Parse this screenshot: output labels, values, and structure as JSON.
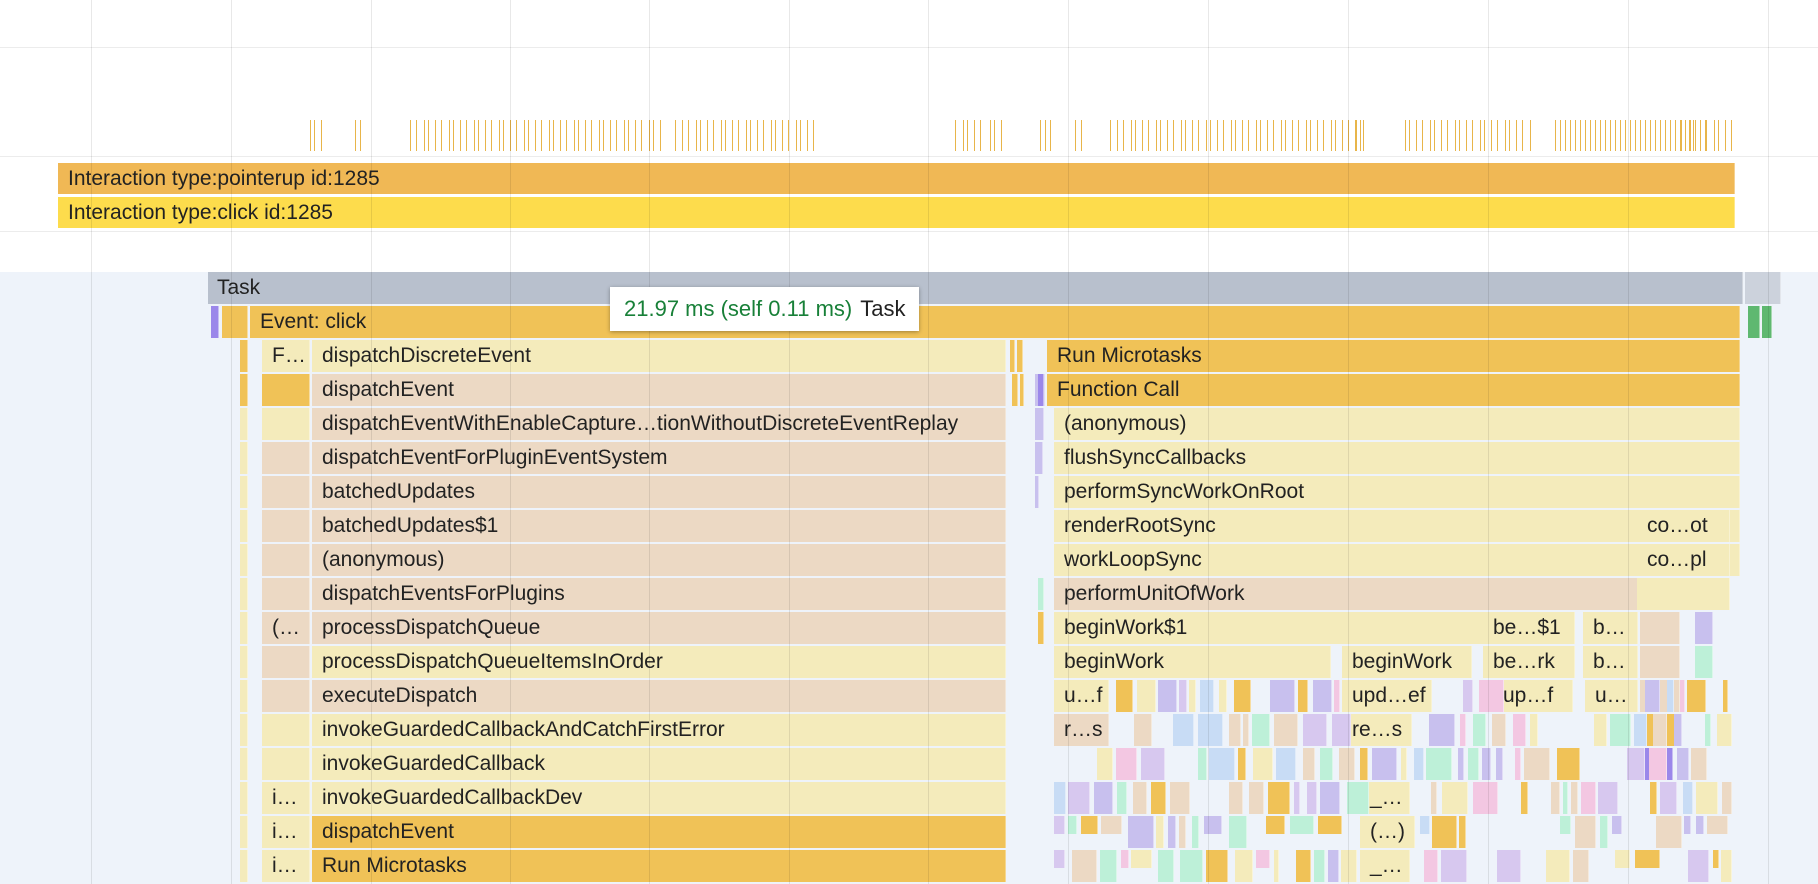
{
  "interactions": [
    {
      "label": "Interaction type:pointerup id:1285",
      "color": "#f0b855"
    },
    {
      "label": "Interaction type:click id:1285",
      "color": "#fddc4c"
    }
  ],
  "tooltip": {
    "duration": "21.97 ms (self 0.11 ms)",
    "name": "Task"
  },
  "task": {
    "label": "Task",
    "color": "#b8c0cd"
  },
  "event": {
    "label": "Event: click"
  },
  "colors": {
    "dark": "#f0c257",
    "light": "#f4ebbb",
    "pink": "#ecd9c4",
    "gray": "#b8c0cd",
    "purple": "#9b87ea",
    "lavender": "#c8c0ee",
    "mint": "#bdf0d8",
    "blue": "#c8dcf5",
    "tip_green": "#188038"
  },
  "left_stack": [
    "dispatchDiscreteEvent",
    "dispatchEvent",
    "dispatchEventWithEnableCapture…tionWithoutDiscreteEventReplay",
    "dispatchEventForPluginEventSystem",
    "batchedUpdates",
    "batchedUpdates$1",
    "(anonymous)",
    "dispatchEventsForPlugins",
    "processDispatchQueue",
    "processDispatchQueueItemsInOrder",
    "executeDispatch",
    "invokeGuardedCallbackAndCatchFirstError",
    "invokeGuardedCallback",
    "invokeGuardedCallbackDev",
    "dispatchEvent",
    "Run Microtasks"
  ],
  "left_small": {
    "f": "F…",
    "p": "(…",
    "i1": "i…",
    "i2": "i…",
    "i3": "i…"
  },
  "right_stack": [
    "Run Microtasks",
    "Function Call",
    "(anonymous)",
    "flushSyncCallbacks",
    "performSyncWorkOnRoot",
    "renderRootSync",
    "workLoopSync",
    "performUnitOfWork"
  ],
  "right_small": {
    "co_ot": "co…ot",
    "co_pl": "co…pl",
    "beginwork1": "beginWork$1",
    "be_1": "be…$1",
    "b_a": "b…",
    "beginwork_a": "beginWork",
    "beginwork_b": "beginWork",
    "be_rk": "be…rk",
    "b_b": "b…",
    "u_f": "u…f",
    "upd_ef": "upd…ef",
    "up_f": "up…f",
    "u_dots": "u…",
    "r_s": "r…s",
    "re_s": "re…s",
    "under1": "_…",
    "paren": "(…)",
    "under2": "_…"
  }
}
